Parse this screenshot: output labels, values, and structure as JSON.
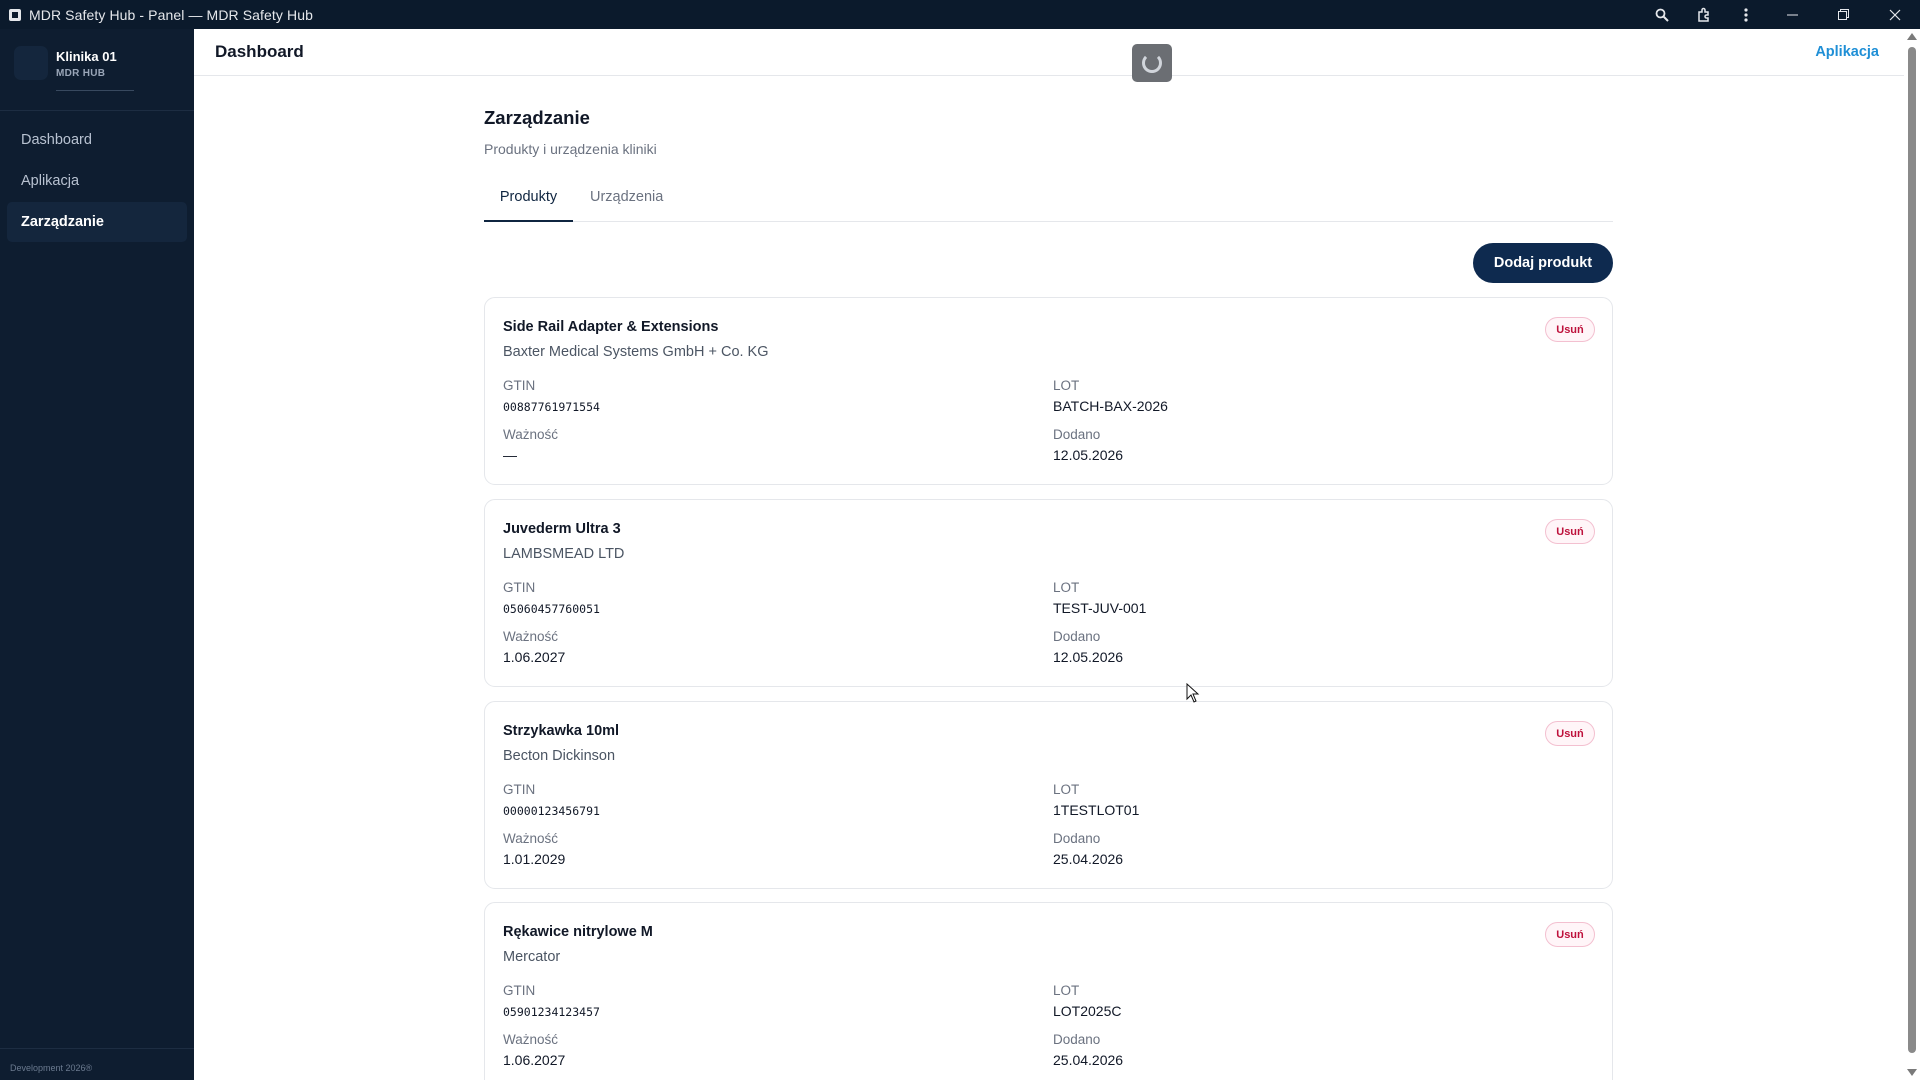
{
  "window": {
    "title": "MDR Safety Hub - Panel — MDR Safety Hub",
    "icons": [
      "app-icon",
      "search-icon",
      "extensions-icon",
      "more-vertical-icon"
    ],
    "controls": [
      "minimize",
      "restore",
      "close"
    ]
  },
  "sidebar": {
    "brand_name": "Klinika 01",
    "brand_sub": "MDR HUB",
    "items": [
      {
        "label": "Dashboard",
        "active": false
      },
      {
        "label": "Aplikacja",
        "active": false
      },
      {
        "label": "Zarządzanie",
        "active": true
      }
    ],
    "footer": "Development 2026®"
  },
  "header": {
    "title": "Dashboard",
    "link": "Aplikacja"
  },
  "main": {
    "title": "Zarządzanie",
    "subtitle": "Produkty i urządzenia kliniki",
    "tabs": [
      {
        "label": "Produkty",
        "active": true
      },
      {
        "label": "Urządzenia",
        "active": false
      }
    ],
    "add_button": "Dodaj produkt",
    "labels": {
      "gtin": "GTIN",
      "lot": "LOT",
      "expiry": "Ważność",
      "added": "Dodano",
      "remove": "Usuń"
    },
    "products": [
      {
        "name": "Side Rail Adapter & Extensions",
        "maker": "Baxter Medical Systems GmbH + Co. KG",
        "gtin": "00887761971554",
        "lot": "BATCH-BAX-2026",
        "expiry": "—",
        "added": "12.05.2026"
      },
      {
        "name": "Juvederm Ultra 3",
        "maker": "LAMBSMEAD LTD",
        "gtin": "05060457760051",
        "lot": "TEST-JUV-001",
        "expiry": "1.06.2027",
        "added": "12.05.2026"
      },
      {
        "name": "Strzykawka 10ml",
        "maker": "Becton Dickinson",
        "gtin": "00000123456791",
        "lot": "1TESTLOT01",
        "expiry": "1.01.2029",
        "added": "25.04.2026"
      },
      {
        "name": "Rękawice nitrylowe M",
        "maker": "Mercator",
        "gtin": "05901234123457",
        "lot": "LOT2025C",
        "expiry": "1.06.2027",
        "added": "25.04.2026"
      }
    ]
  },
  "colors": {
    "sidebar_bg": "#0e1d30",
    "titlebar_bg": "#0b1a2c",
    "primary_button": "#0e2a4f",
    "link": "#1f8fd6",
    "remove": "#be123c"
  }
}
